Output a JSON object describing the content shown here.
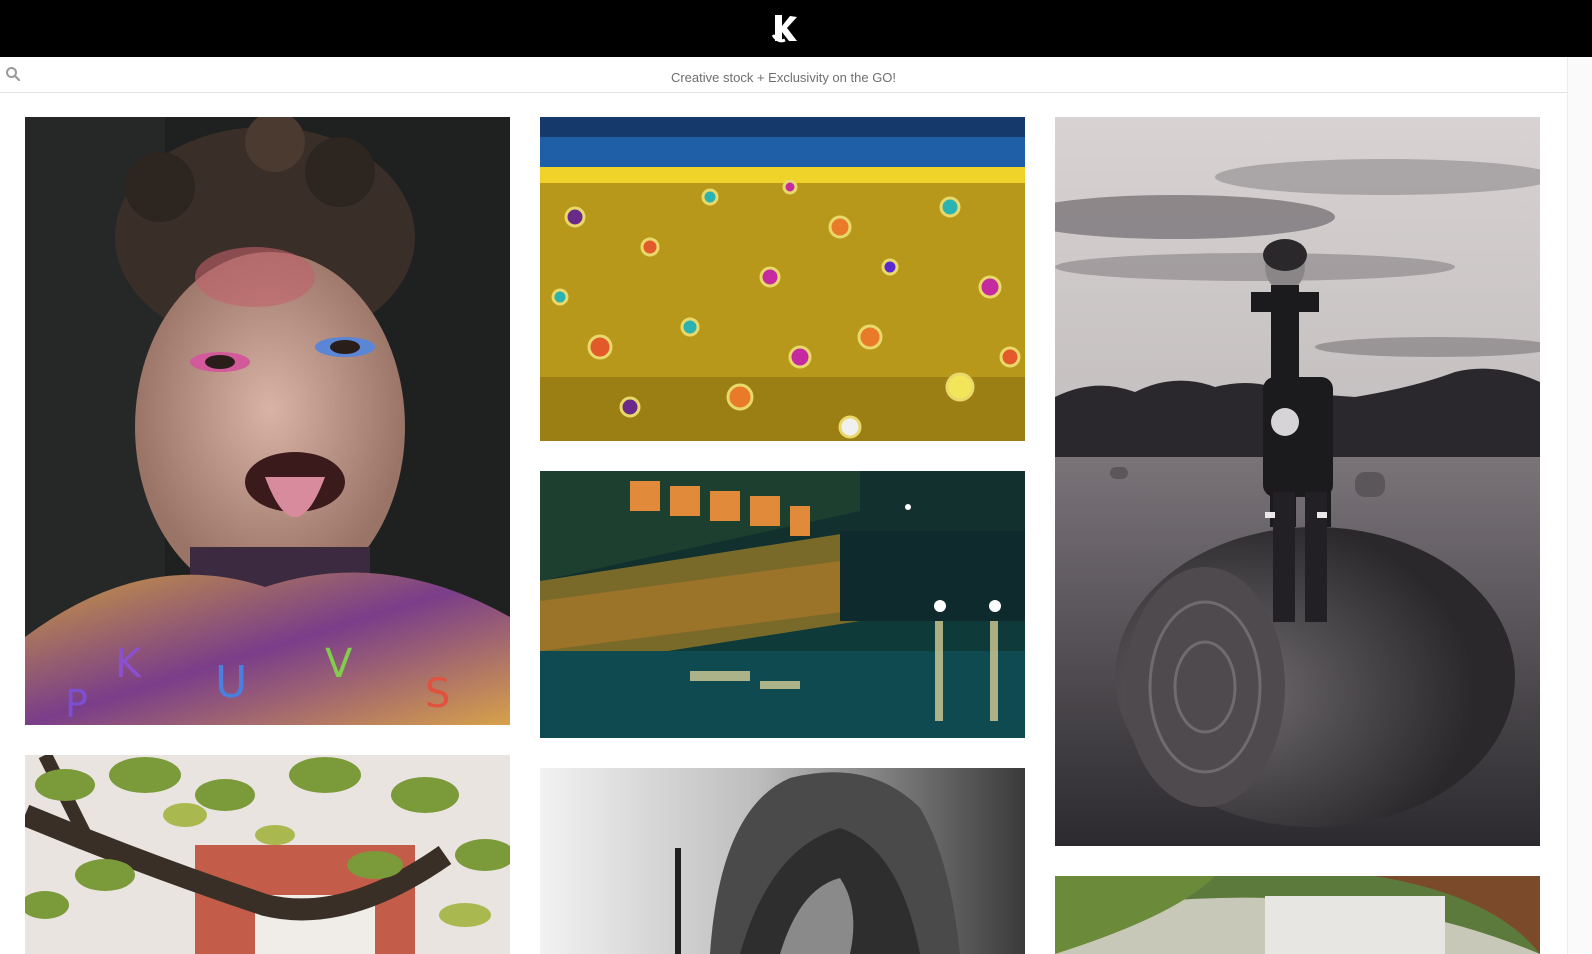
{
  "header": {
    "logo_icon": "k-logo-icon",
    "background": "#000000"
  },
  "search": {
    "icon": "search-icon",
    "tagline": "Creative stock + Exclusivity on the GO!"
  },
  "gallery": {
    "columns": 3,
    "photos": [
      {
        "id": "portrait-painted-girl",
        "subject": "face-paint portrait"
      },
      {
        "id": "yellow-dots",
        "subject": "abstract yellow paint dots"
      },
      {
        "id": "night-street",
        "subject": "rainy night street"
      },
      {
        "id": "boy-hay-bale",
        "subject": "boy standing on hay bale"
      },
      {
        "id": "tree-branch",
        "subject": "tree branch leaves"
      },
      {
        "id": "hooded-figure",
        "subject": "hooded figure black and white"
      },
      {
        "id": "green-mirror",
        "subject": "green blurred object"
      }
    ]
  }
}
